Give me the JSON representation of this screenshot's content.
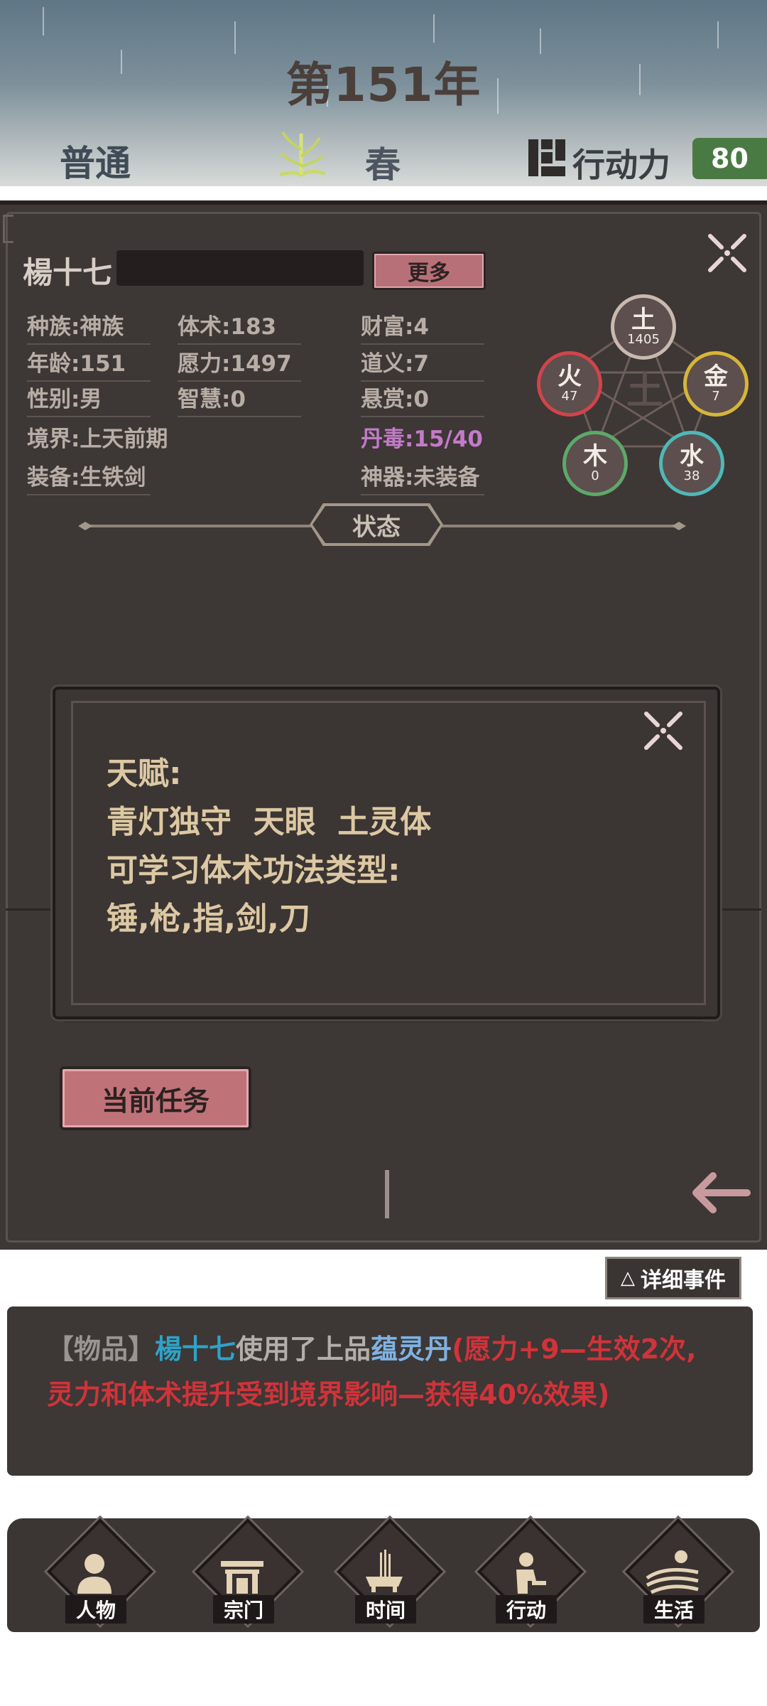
{
  "header": {
    "year": "第151年",
    "difficulty": "普通",
    "season": "春",
    "action_points_label": "行动力",
    "action_points_value": "80"
  },
  "character": {
    "name": "楊十七",
    "more_button": "更多",
    "stats": {
      "race": "种族:神族",
      "body_art": "体术:183",
      "wealth": "财富:4",
      "age": "年龄:151",
      "willpower": "愿力:1497",
      "righteousness": "道义:7",
      "gender": "性别:男",
      "wisdom": "智慧:0",
      "bounty": "悬赏:0",
      "realm": "境界:上天前期",
      "pill_toxin": "丹毒:15/40",
      "equipment": "装备:生铁剑",
      "artifact": "神器:未装备"
    },
    "elements": {
      "earth": {
        "char": "土",
        "value": "1405",
        "color": "#c9b9b0"
      },
      "fire": {
        "char": "火",
        "value": "47",
        "color": "#d0444b"
      },
      "metal": {
        "char": "金",
        "value": "7",
        "color": "#d6b53a"
      },
      "wood": {
        "char": "木",
        "value": "0",
        "color": "#5ea86a"
      },
      "water": {
        "char": "水",
        "value": "38",
        "color": "#4fb8b8"
      },
      "center_char": "土"
    },
    "status_label": "状态"
  },
  "talent_popup": {
    "talent_heading": "天赋:",
    "talents": "青灯独守  天眼  土灵体",
    "learnable_heading": "可学习体术功法类型:",
    "learnable_types": "锤,枪,指,剑,刀"
  },
  "current_task_button": "当前任务",
  "events": {
    "detail_button": "详细事件",
    "detail_icon": "triangle-up-icon",
    "tag": "【物品】",
    "actor": "楊十七",
    "action": "使用了上品",
    "item": "蕴灵丹",
    "effect": "(愿力+9—生效2次,灵力和体术提升受到境界影响—获得40%效果)"
  },
  "nav": {
    "items": [
      {
        "label": "人物",
        "icon": "person-icon"
      },
      {
        "label": "宗门",
        "icon": "gate-icon"
      },
      {
        "label": "时间",
        "icon": "incense-icon"
      },
      {
        "label": "行动",
        "icon": "action-icon"
      },
      {
        "label": "生活",
        "icon": "landscape-icon"
      }
    ]
  }
}
